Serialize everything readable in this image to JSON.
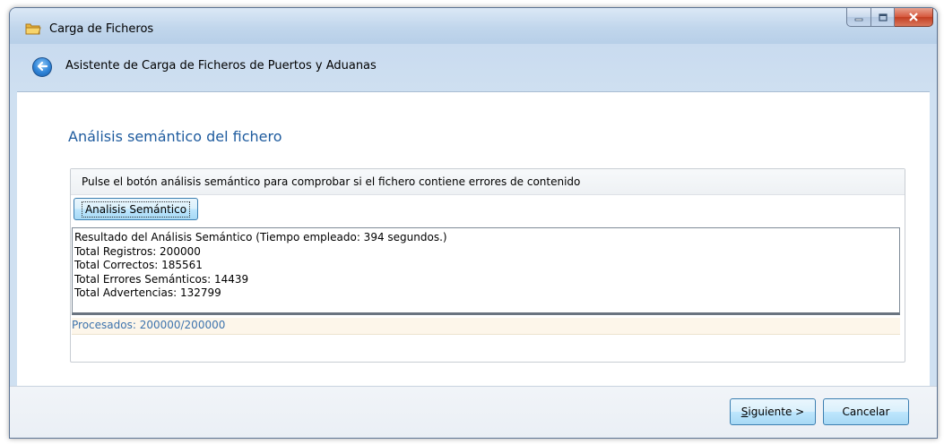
{
  "window": {
    "title": "Carga de Ficheros",
    "app_icon": "folder-icon"
  },
  "nav": {
    "back_icon": "back-arrow-icon",
    "wizard_title": "Asistente de Carga de Ficheros de Puertos y Aduanas"
  },
  "page": {
    "heading": "Análisis semántico del fichero",
    "instruction": "Pulse el botón análisis semántico para comprobar si el fichero contiene errores de contenido",
    "analyze_button": "Analisis Semántico",
    "results": [
      "Resultado del Análisis Semántico (Tiempo empleado: 394 segundos.)",
      "Total Registros: 200000",
      "Total Correctos: 185561",
      "Total Errores Semánticos: 14439",
      "Total Advertencias: 132799"
    ],
    "progress": "Procesados: 200000/200000"
  },
  "footer": {
    "next_mnemonic": "S",
    "next_rest": "iguiente >",
    "cancel": "Cancelar"
  },
  "colors": {
    "heading": "#1e5b9e",
    "progress_text": "#3d73ad",
    "close_button": "#c33f22"
  }
}
